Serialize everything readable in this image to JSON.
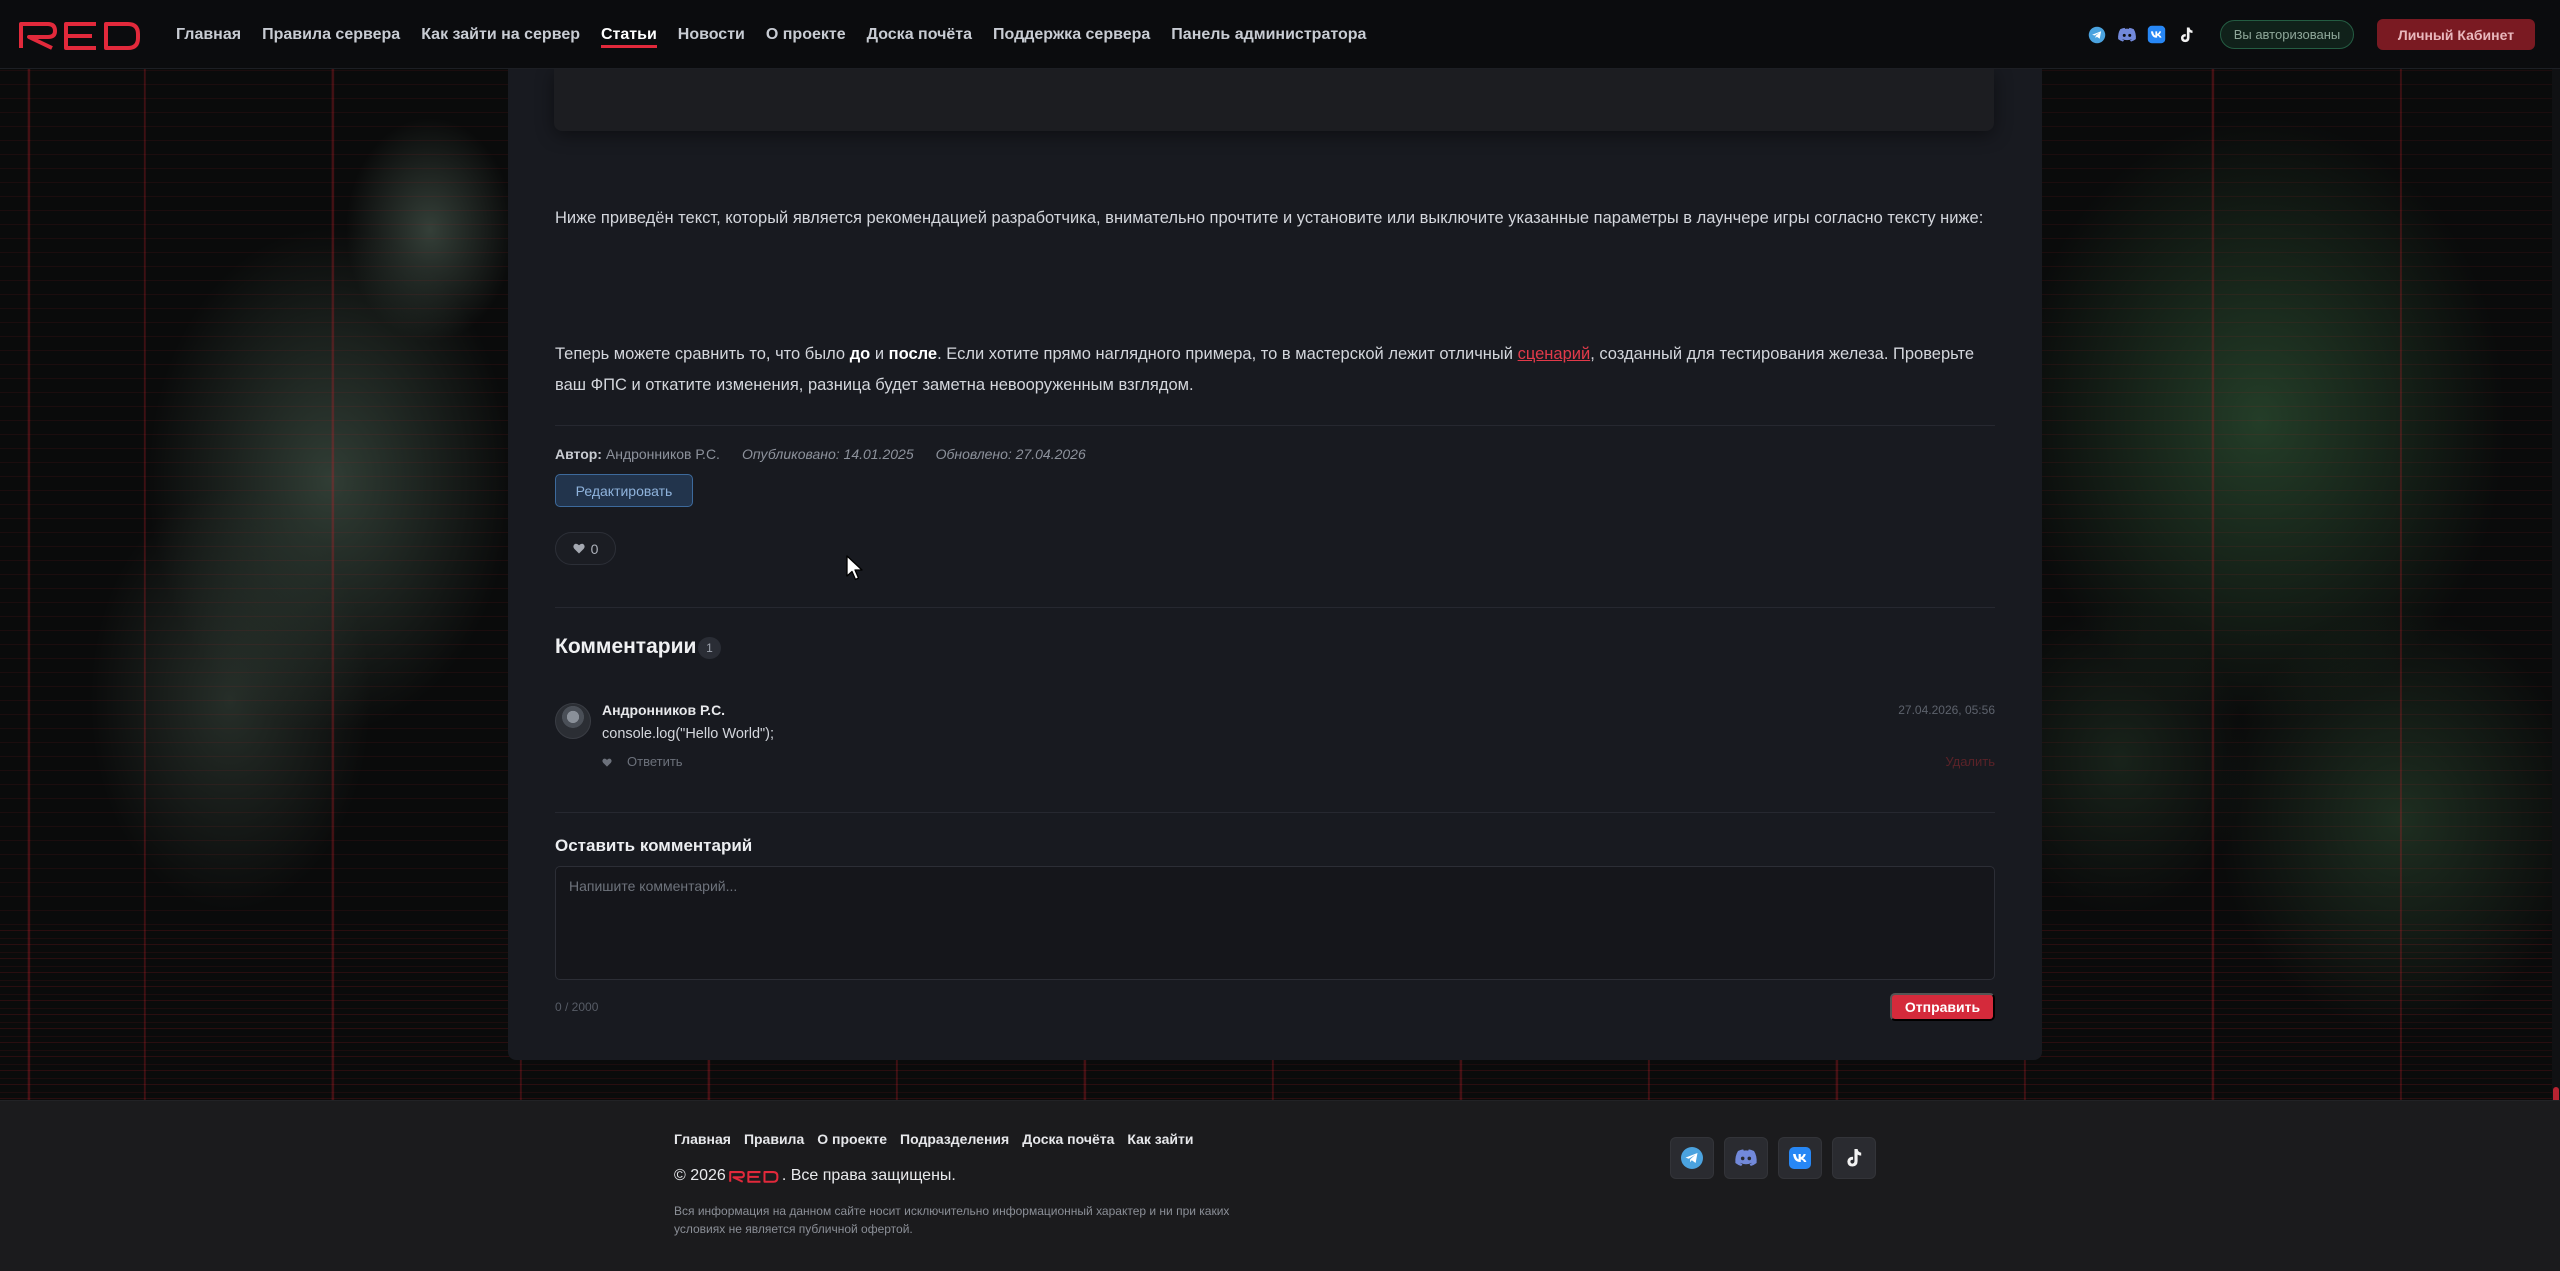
{
  "nav": {
    "links": [
      {
        "label": "Главная",
        "active": false
      },
      {
        "label": "Правила сервера",
        "active": false
      },
      {
        "label": "Как зайти на сервер",
        "active": false
      },
      {
        "label": "Статьи",
        "active": true
      },
      {
        "label": "Новости",
        "active": false
      },
      {
        "label": "О проекте",
        "active": false
      },
      {
        "label": "Доска почёта",
        "active": false
      },
      {
        "label": "Поддержка сервера",
        "active": false
      },
      {
        "label": "Панель администратора",
        "active": false
      }
    ],
    "social_icons": [
      "telegram-icon",
      "discord-icon",
      "vk-icon",
      "tiktok-icon"
    ],
    "auth_status": "Вы авторизованы",
    "cabinet_label": "Личный Кабинет"
  },
  "article": {
    "para1": "Ниже приведён текст, который является рекомендацией разработчика, внимательно прочтите и установите или выключите указанные параметры в лаунчере игры согласно тексту ниже:",
    "para2": {
      "part1": "Теперь можете сравнить то, что было ",
      "bold1": "до",
      "part2": " и ",
      "bold2": "после",
      "part3": ". Если хотите прямо наглядного примера, то в мастерской лежит отличный ",
      "link": "сценарий",
      "part4": ", созданный для тестирования железа. Проверьте ваш ФПС и откатите изменения, разница будет заметна невооруженным взглядом."
    },
    "meta": {
      "author_label": "Автор:",
      "author": "Андронников Р.С.",
      "published": "Опубликовано: 14.01.2025",
      "updated": "Обновлено: 27.04.2026"
    },
    "edit_label": "Редактировать",
    "likes": "0"
  },
  "comments": {
    "title": "Комментарии",
    "count": "1",
    "items": [
      {
        "author": "Андронников Р.С.",
        "date": "27.04.2026, 05:56",
        "text": "console.log(\"Hello World\");",
        "reply_label": "Ответить",
        "delete_label": "Удалить"
      }
    ],
    "leave_title": "Оставить комментарий",
    "placeholder": "Напишите комментарий...",
    "char_count": "0 / 2000",
    "send_label": "Отправить"
  },
  "footer": {
    "links": [
      "Главная",
      "Правила",
      "О проекте",
      "Подразделения",
      "Доска почёта",
      "Как зайти"
    ],
    "copyright_prefix": "© 2026",
    "copyright_suffix": ". Все права защищены.",
    "disclaimer": "Вся информация на данном сайте носит исключительно информационный характер и ни при каких условиях не является публичной офертой.",
    "social_icons": [
      "telegram-icon",
      "discord-icon",
      "vk-icon",
      "tiktok-icon"
    ]
  },
  "colors": {
    "accent": "#e2293b",
    "card_bg": "#181a20",
    "nav_bg": "#0b0c0e",
    "footer_bg": "#1b1b1d"
  }
}
